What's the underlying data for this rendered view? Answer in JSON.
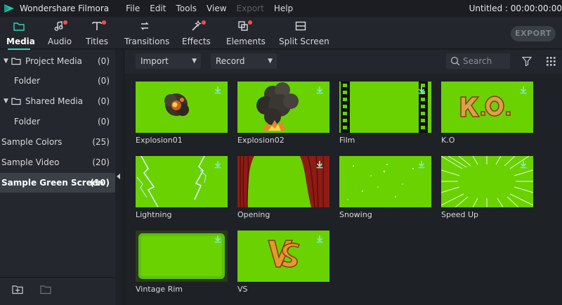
{
  "app": {
    "name": "Wondershare Filmora",
    "document_title": "Untitled : 00:00:00:00"
  },
  "menu": [
    "File",
    "Edit",
    "Tools",
    "View",
    "Export",
    "Help"
  ],
  "toolbar": {
    "tabs": [
      {
        "label": "Media",
        "icon": "folder-icon",
        "active": true,
        "has_dot": false
      },
      {
        "label": "Audio",
        "icon": "music-note-icon",
        "active": false,
        "has_dot": true
      },
      {
        "label": "Titles",
        "icon": "text-icon",
        "active": false,
        "has_dot": true
      },
      {
        "label": "Transitions",
        "icon": "transition-icon",
        "active": false,
        "has_dot": false
      },
      {
        "label": "Effects",
        "icon": "effects-icon",
        "active": false,
        "has_dot": true
      },
      {
        "label": "Elements",
        "icon": "elements-icon",
        "active": false,
        "has_dot": true
      },
      {
        "label": "Split Screen",
        "icon": "split-screen-icon",
        "active": false,
        "has_dot": false
      }
    ],
    "export_label": "EXPORT",
    "dot_color": "#ff4d4d",
    "accent_color": "#2fd7b5"
  },
  "sidebar": {
    "items": [
      {
        "label": "Project Media",
        "count": "(0)",
        "expandable": true,
        "icon": "folder-icon"
      },
      {
        "label": "Folder",
        "count": "(0)",
        "expandable": false
      },
      {
        "label": "Shared Media",
        "count": "(0)",
        "expandable": true,
        "icon": "folder-icon"
      },
      {
        "label": "Folder",
        "count": "(0)",
        "expandable": false
      },
      {
        "label": "Sample Colors",
        "count": "(25)",
        "expandable": false
      },
      {
        "label": "Sample Video",
        "count": "(20)",
        "expandable": false
      },
      {
        "label": "Sample Green Screen",
        "count": "(10)",
        "expandable": false,
        "selected": true
      }
    ],
    "footer_icons": [
      "new-folder-icon",
      "folder-outline-icon"
    ]
  },
  "filters": {
    "import_label": "Import",
    "record_label": "Record",
    "search_placeholder": "Search",
    "icons": [
      "filter-icon",
      "grid-view-icon"
    ]
  },
  "media": [
    {
      "label": "Explosion01",
      "art": "explosion-small"
    },
    {
      "label": "Explosion02",
      "art": "explosion-large"
    },
    {
      "label": "Film",
      "art": "film-strip"
    },
    {
      "label": "K.O",
      "art": "ko-text"
    },
    {
      "label": "Lightning",
      "art": "lightning"
    },
    {
      "label": "Opening",
      "art": "curtains"
    },
    {
      "label": "Snowing",
      "art": "snow"
    },
    {
      "label": "Speed Up",
      "art": "speed-lines"
    },
    {
      "label": "Vintage Rim",
      "art": "vintage-rim"
    },
    {
      "label": "VS",
      "art": "vs-text"
    }
  ],
  "colors": {
    "green_screen": "#6ad200",
    "download_icon": "#7fe7c4"
  }
}
